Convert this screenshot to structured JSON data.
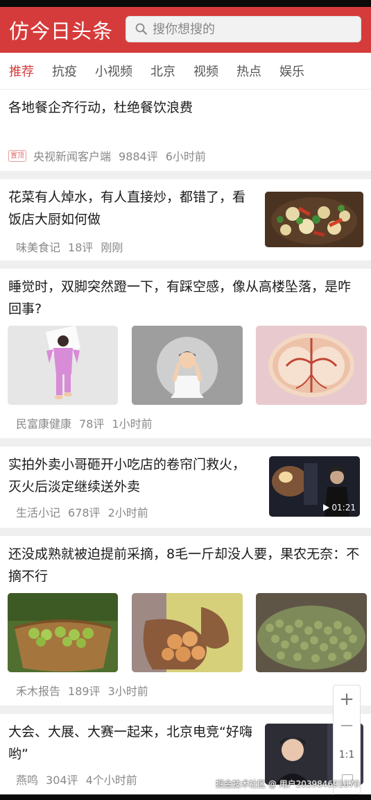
{
  "header": {
    "title": "仿今日头条",
    "search_placeholder": "搜你想搜的"
  },
  "tabs": [
    "推荐",
    "抗疫",
    "小视频",
    "北京",
    "视频",
    "热点",
    "娱乐"
  ],
  "news": [
    {
      "title": "各地餐企齐行动，杜绝餐饮浪费",
      "badge": "置顶",
      "source": "央视新闻客户端",
      "comments": "9884评",
      "time": "6小时前"
    },
    {
      "title": "花菜有人焯水，有人直接炒，都错了，看饭店大厨如何做",
      "source": "味美食记",
      "comments": "18评",
      "time": "刚刚"
    },
    {
      "title": "睡觉时，双脚突然蹬一下，有踩空感，像从高楼坠落，是咋回事?",
      "source": "民富康健康",
      "comments": "78评",
      "time": "1小时前"
    },
    {
      "title": "实拍外卖小哥砸开小吃店的卷帘门救火，灭火后淡定继续送外卖",
      "source": "生活小记",
      "comments": "678评",
      "time": "2小时前",
      "video_duration": "01:21"
    },
    {
      "title": "还没成熟就被迫提前采摘，8毛一斤却没人要，果农无奈：不摘不行",
      "source": "禾木报告",
      "comments": "189评",
      "time": "3小时前"
    },
    {
      "title": "大会、大展、大赛一起来，北京电竞“好嗨哟”",
      "source": "燕鸣",
      "comments": "304评",
      "time": "4个小时前"
    }
  ],
  "zoom": {
    "in": "+",
    "out": "—",
    "reset": "1:1"
  },
  "watermark": "掘金技术社区 @ 用户2039846910​70",
  "colors": {
    "brand": "#d63b3b",
    "tab_active": "#d43d3d"
  }
}
